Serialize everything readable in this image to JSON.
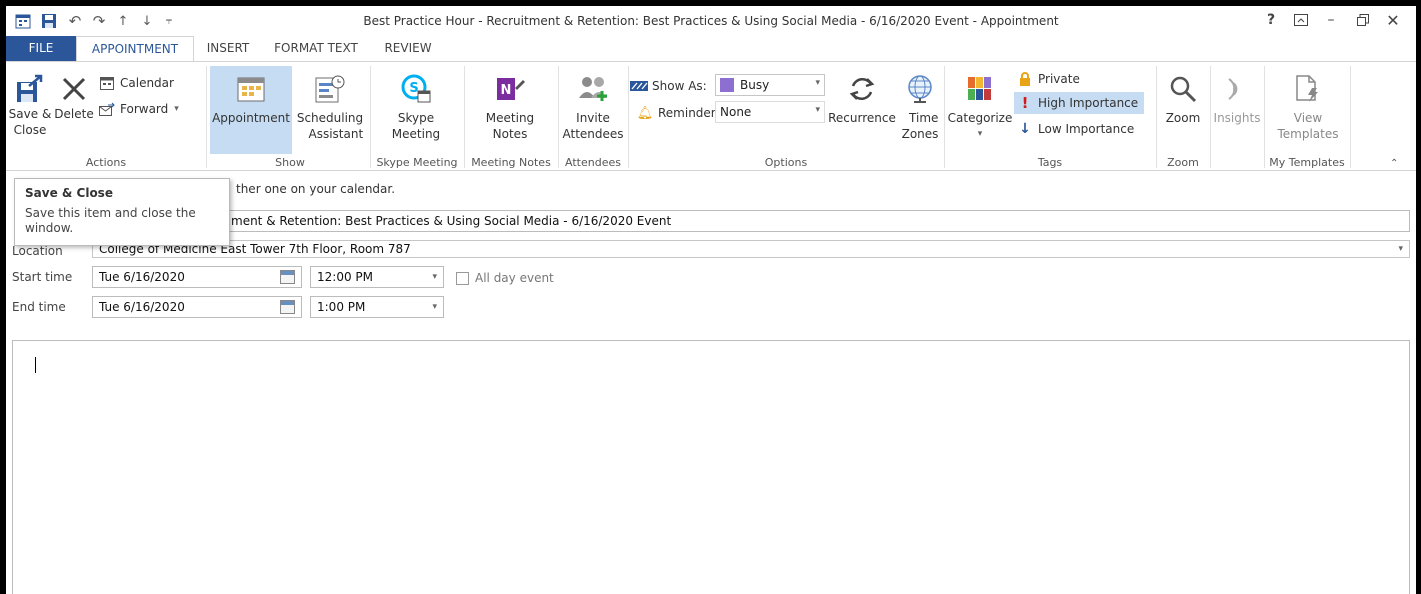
{
  "window": {
    "title": "Best Practice Hour - Recruitment & Retention: Best Practices & Using Social Media - 6/16/2020 Event - Appointment",
    "controls": [
      "?",
      "ribbon-display",
      "minimize",
      "restore",
      "close"
    ]
  },
  "qat": {
    "icons": [
      "appointment-icon",
      "save-icon",
      "undo-icon",
      "redo-icon",
      "previous-item-icon",
      "next-item-icon",
      "customize-qat-icon"
    ]
  },
  "tabs": [
    "FILE",
    "APPOINTMENT",
    "INSERT",
    "FORMAT TEXT",
    "REVIEW"
  ],
  "active_tab": "APPOINTMENT",
  "ribbon": {
    "actions": {
      "label": "Actions",
      "save_close_1": "Save &",
      "save_close_2": "Close",
      "delete": "Delete",
      "calendar": "Calendar",
      "forward": "Forward"
    },
    "show": {
      "label": "Show",
      "appointment": "Appointment",
      "scheduling_1": "Scheduling",
      "scheduling_2": "Assistant"
    },
    "skype": {
      "label": "Skype Meeting",
      "btn_1": "Skype",
      "btn_2": "Meeting"
    },
    "notes": {
      "label": "Meeting Notes",
      "btn_1": "Meeting",
      "btn_2": "Notes"
    },
    "attendees": {
      "label": "Attendees",
      "btn_1": "Invite",
      "btn_2": "Attendees"
    },
    "options": {
      "label": "Options",
      "show_as_label": "Show As:",
      "show_as_value": "Busy",
      "reminder_label": "Reminder:",
      "reminder_value": "None",
      "recurrence": "Recurrence",
      "time_zones_1": "Time",
      "time_zones_2": "Zones"
    },
    "tags": {
      "label": "Tags",
      "categorize": "Categorize",
      "private": "Private",
      "high": "High Importance",
      "low": "Low Importance"
    },
    "zoom": {
      "label": "Zoom",
      "btn": "Zoom"
    },
    "insights": {
      "btn": "Insights"
    },
    "templates": {
      "label": "My Templates",
      "btn_1": "View",
      "btn_2": "Templates"
    }
  },
  "form": {
    "info_text": "ther one on your calendar.",
    "subject_value": "ment & Retention: Best Practices & Using Social Media - 6/16/2020 Event",
    "location_label": "Location",
    "location_value": "College of Medicine East Tower 7th Floor, Room 787",
    "start_label": "Start time",
    "start_date": "Tue 6/16/2020",
    "start_time": "12:00 PM",
    "all_day": "All day event",
    "end_label": "End time",
    "end_date": "Tue 6/16/2020",
    "end_time": "1:00 PM"
  },
  "tooltip": {
    "title": "Save & Close",
    "body_1": "Save this item and close the",
    "body_2": "window."
  },
  "colors": {
    "accent": "#2b579a",
    "selected": "#c5dcf2",
    "busy": "#8c6fd1",
    "high_importance": "#d01c1c",
    "low_importance": "#2b579a"
  }
}
